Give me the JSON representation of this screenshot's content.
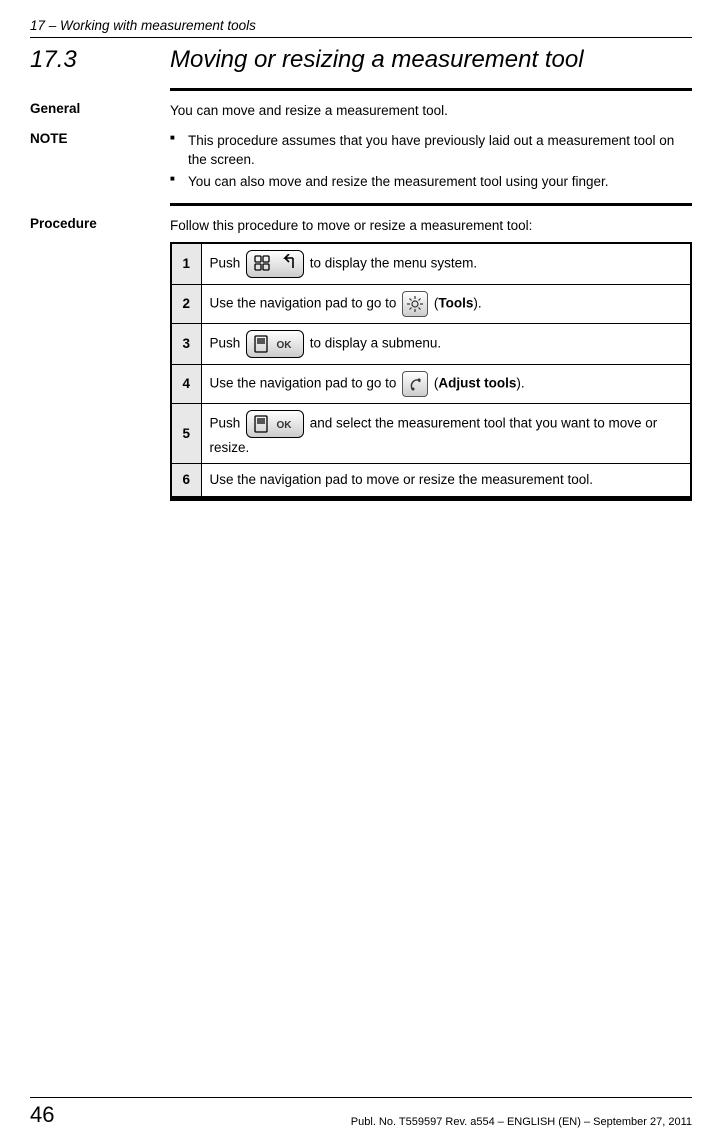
{
  "header": {
    "chapter_ref": "17 – Working with measurement tools"
  },
  "section": {
    "number": "17.3",
    "title": "Moving or resizing a measurement tool"
  },
  "general": {
    "label": "General",
    "text": "You can move and resize a measurement tool."
  },
  "note": {
    "label": "NOTE",
    "items": [
      "This procedure assumes that you have previously laid out a measurement tool on the screen.",
      "You can also move and resize the measurement tool using your finger."
    ]
  },
  "procedure": {
    "label": "Procedure",
    "intro": "Follow this procedure to move or resize a measurement tool:",
    "steps": [
      {
        "n": "1",
        "pre": "Push ",
        "post": " to display the menu system."
      },
      {
        "n": "2",
        "pre": "Use the navigation pad to go to ",
        "paren_label": "Tools",
        "post": "."
      },
      {
        "n": "3",
        "pre": "Push ",
        "post": " to display a submenu."
      },
      {
        "n": "4",
        "pre": "Use the navigation pad to go to ",
        "paren_label": "Adjust tools",
        "post": "."
      },
      {
        "n": "5",
        "pre": "Push ",
        "post": " and select the measurement tool that you want to move or resize."
      },
      {
        "n": "6",
        "text": "Use the navigation pad to move or resize the measurement tool."
      }
    ]
  },
  "footer": {
    "page": "46",
    "pub": "Publ. No. T559597 Rev. a554 – ENGLISH (EN) – September 27, 2011"
  }
}
